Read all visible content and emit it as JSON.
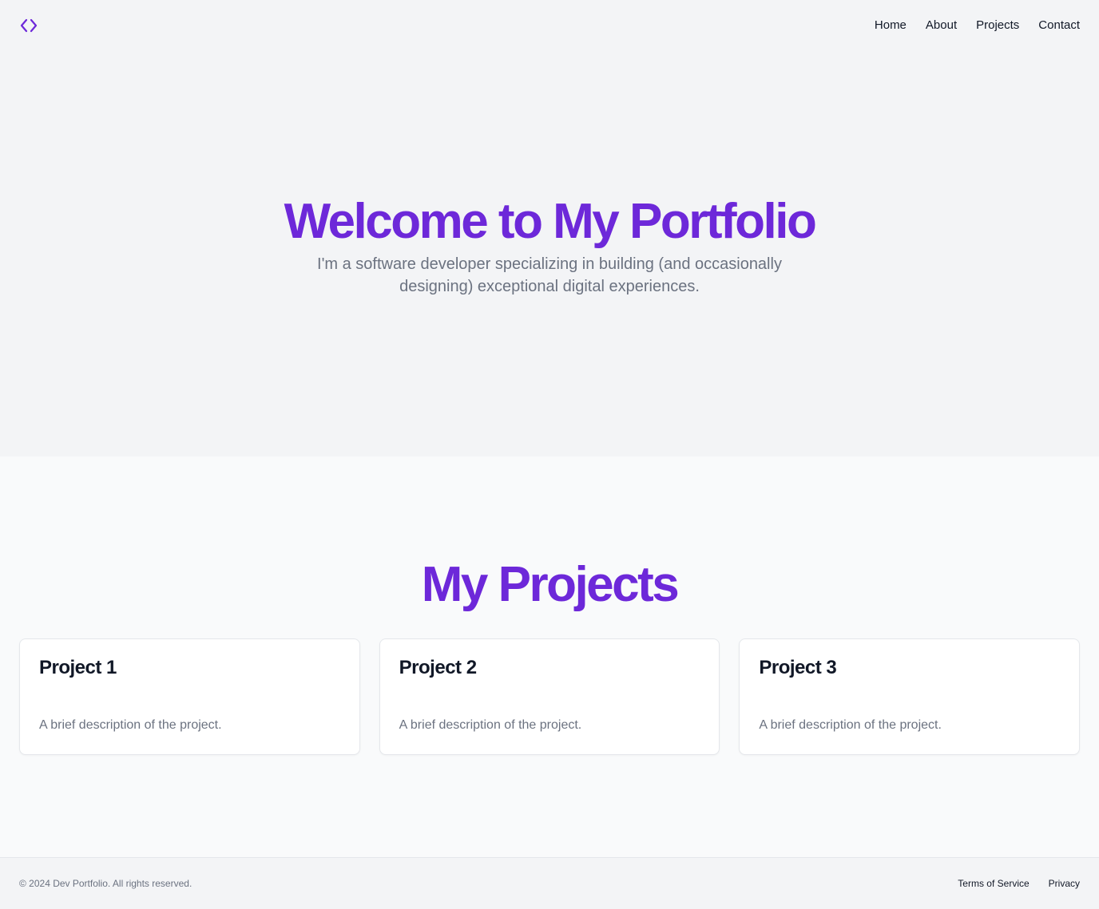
{
  "brand": {
    "logo_icon": "code-brackets-icon",
    "accent_color": "#6d28d9"
  },
  "nav": {
    "items": [
      {
        "label": "Home"
      },
      {
        "label": "About"
      },
      {
        "label": "Projects"
      },
      {
        "label": "Contact"
      }
    ]
  },
  "hero": {
    "title": "Welcome to My Portfolio",
    "subtitle": "I'm a software developer specializing in building (and occasionally designing) exceptional digital experiences."
  },
  "projects": {
    "heading": "My Projects",
    "items": [
      {
        "title": "Project 1",
        "description": "A brief description of the project."
      },
      {
        "title": "Project 2",
        "description": "A brief description of the project."
      },
      {
        "title": "Project 3",
        "description": "A brief description of the project."
      }
    ]
  },
  "footer": {
    "copyright": "© 2024 Dev Portfolio. All rights reserved.",
    "links": [
      {
        "label": "Terms of Service"
      },
      {
        "label": "Privacy"
      }
    ]
  }
}
